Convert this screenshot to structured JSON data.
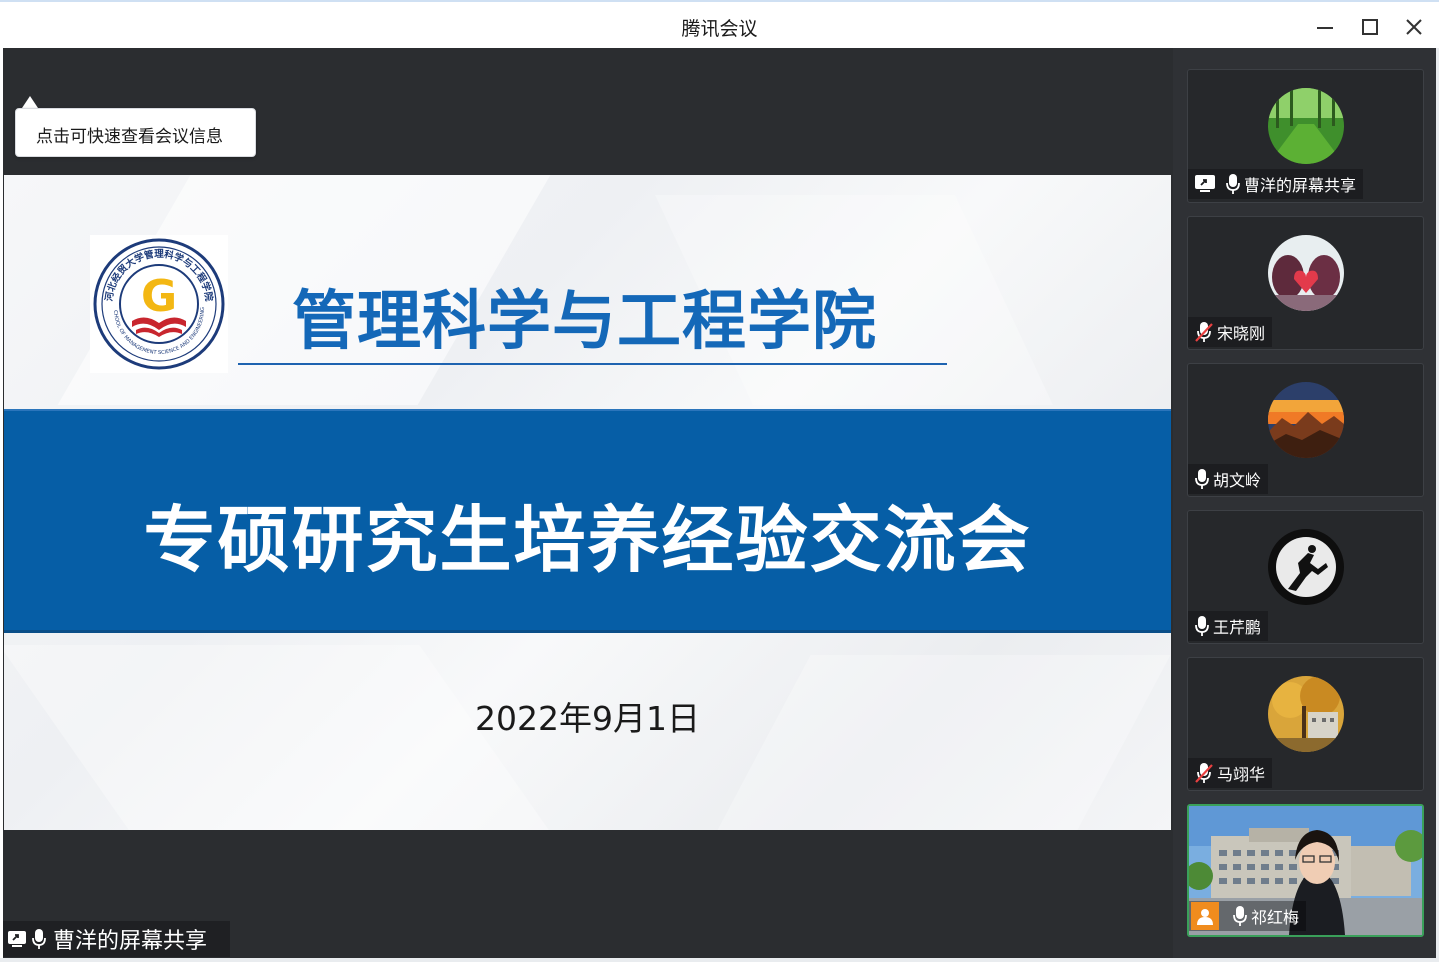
{
  "window": {
    "title": "腾讯会议"
  },
  "tooltip": {
    "text": "点击可快速查看会议信息"
  },
  "slide": {
    "org_name": "管理科学与工程学院",
    "headline": "专硕研究生培养经验交流会",
    "date": "2022年9月1日",
    "logo": {
      "letter": "G",
      "ring_text_top": "河北经贸大学管理科学与工程学院",
      "ring_text_bottom": "SCHOOL OF MANAGEMENT SCIENCE AND ENGINEERING"
    }
  },
  "share_label": {
    "text": "曹洋的屏幕共享"
  },
  "participants": [
    {
      "name": "曹洋的屏幕共享",
      "mic": "on",
      "screen_share": true,
      "avatar": "forest"
    },
    {
      "name": "宋晓刚",
      "mic": "muted",
      "avatar": "heart-leaves"
    },
    {
      "name": "胡文岭",
      "mic": "on",
      "avatar": "sunset-mountains"
    },
    {
      "name": "王芹鹏",
      "mic": "on",
      "avatar": "moon-silhouette"
    },
    {
      "name": "马翊华",
      "mic": "muted",
      "avatar": "autumn-tree"
    },
    {
      "name": "祁红梅",
      "mic": "on",
      "video": true,
      "speaking": true,
      "avatar": "video-feed"
    }
  ],
  "colors": {
    "brand_blue": "#065ea6",
    "title_blue": "#1468b8",
    "logo_red": "#c8262e",
    "logo_gold": "#f3b713",
    "active_border": "#3aa05a",
    "host_badge": "#f08c1e"
  }
}
